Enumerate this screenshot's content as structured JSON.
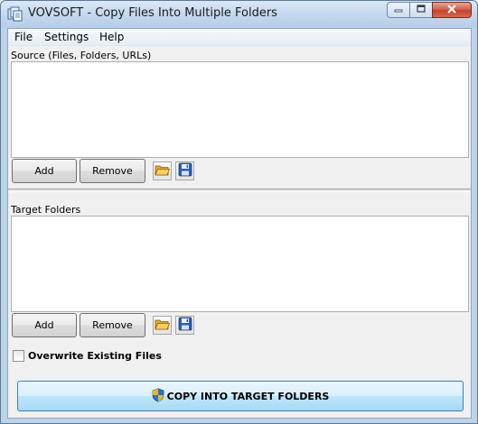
{
  "window": {
    "title": "VOVSOFT - Copy Files Into Multiple Folders",
    "icon": "copy-files-app-icon"
  },
  "menu": {
    "items": [
      "File",
      "Settings",
      "Help"
    ]
  },
  "source": {
    "label": "Source (Files, Folders, URLs)",
    "items": [],
    "add_label": "Add",
    "remove_label": "Remove",
    "open_icon": "folder-open-icon",
    "save_icon": "save-disk-icon"
  },
  "target": {
    "label": "Target Folders",
    "items": [],
    "add_label": "Add",
    "remove_label": "Remove",
    "open_icon": "folder-open-icon",
    "save_icon": "save-disk-icon"
  },
  "options": {
    "overwrite_label": "Overwrite Existing Files",
    "overwrite_checked": false
  },
  "action": {
    "label": "COPY INTO TARGET FOLDERS",
    "icon": "uac-shield-icon"
  },
  "colors": {
    "accent": "#3c7fb1",
    "close_button": "#c5422c"
  }
}
